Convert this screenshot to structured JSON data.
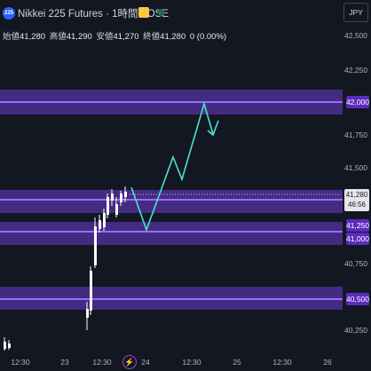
{
  "header": {
    "symbol_badge": "225",
    "title": "Nikkei 225 Futures · 1時間 · OSE",
    "currency": "JPY"
  },
  "ohlc": {
    "open_label": "始値",
    "open": "41,280",
    "high_label": "高値",
    "high": "41,290",
    "low_label": "安値",
    "low": "41,270",
    "close_label": "終値",
    "close": "41,280",
    "change": "0 (0.00%)"
  },
  "y_axis": {
    "ticks": [
      "42,500",
      "42,250",
      "41,750",
      "41,500",
      "40,750",
      "40,250"
    ]
  },
  "x_axis": {
    "ticks": [
      "12:30",
      "23",
      "12:30",
      "24",
      "12:30",
      "25",
      "12:30",
      "26"
    ]
  },
  "price_labels": {
    "zone_1": "42,000",
    "zone_2a": "41,250",
    "zone_2b": "41,000",
    "zone_3": "40,500",
    "last_price": "41,280",
    "countdown": "46:56"
  },
  "colors": {
    "background": "#131722",
    "zone": "#6e3cd2",
    "projection": "#4ee0d0",
    "candle_up": "#ffffff",
    "candle_down": "#ffffff"
  },
  "icons": {
    "bolt": "lightning-icon",
    "status": "market-status-dot-icon",
    "event": "event-flash-icon"
  }
}
